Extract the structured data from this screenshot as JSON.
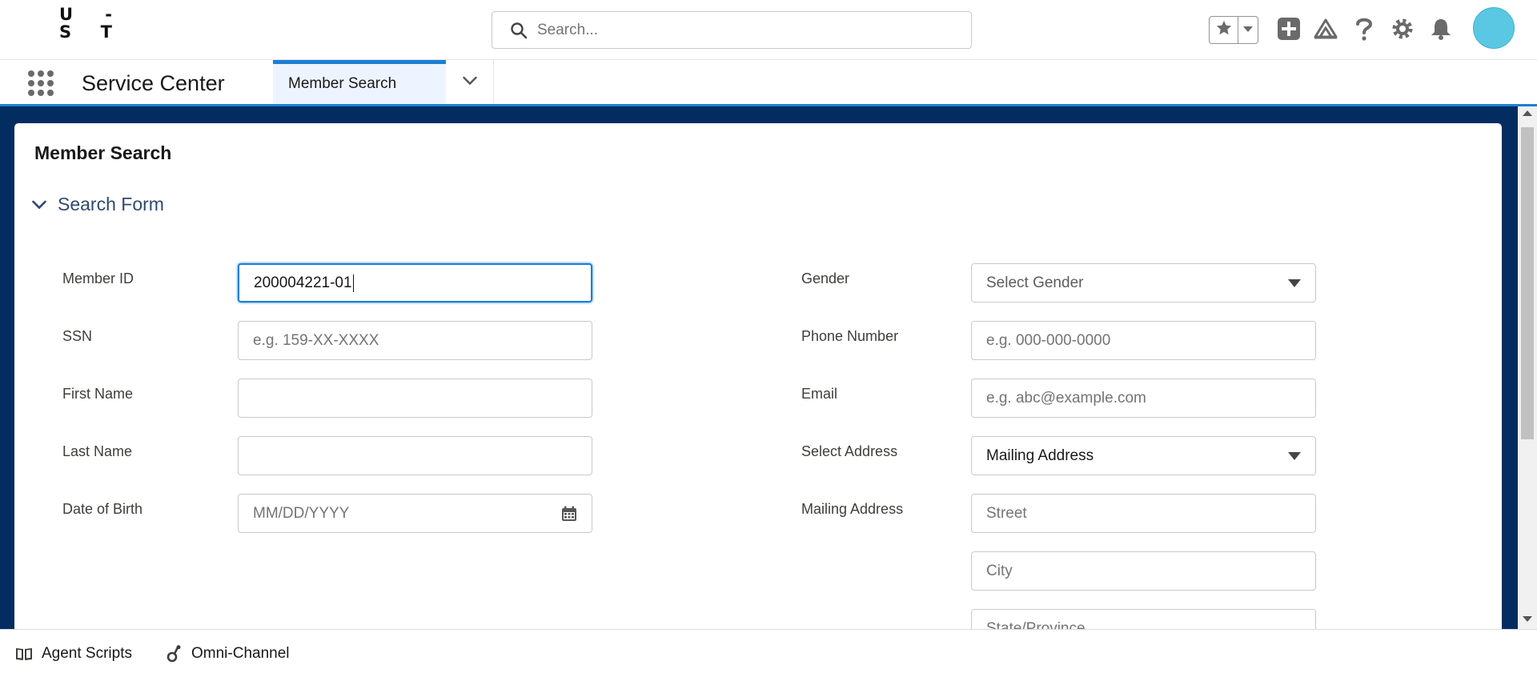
{
  "header": {
    "logo_line1": [
      "U",
      "-"
    ],
    "logo_line2": [
      "S",
      "T"
    ],
    "search_placeholder": "Search...",
    "icons": [
      "star-icon",
      "chevron-down-icon",
      "add-icon",
      "trailhead-icon",
      "help-icon",
      "gear-icon",
      "bell-icon"
    ],
    "avatar_color": "#5ac8e3"
  },
  "nav": {
    "app_name": "Service Center",
    "tabs": [
      {
        "label": "Member Search",
        "active": true
      }
    ]
  },
  "page": {
    "title": "Member Search",
    "section_label": "Search Form"
  },
  "form": {
    "member_id": {
      "label": "Member ID",
      "value": "200004221-01"
    },
    "ssn": {
      "label": "SSN",
      "placeholder": "e.g. 159-XX-XXXX"
    },
    "first_name": {
      "label": "First Name",
      "value": ""
    },
    "last_name": {
      "label": "Last Name",
      "value": ""
    },
    "dob": {
      "label": "Date of Birth",
      "placeholder": "MM/DD/YYYY"
    },
    "gender": {
      "label": "Gender",
      "placeholder": "Select Gender"
    },
    "phone": {
      "label": "Phone Number",
      "placeholder": "e.g. 000-000-0000"
    },
    "email": {
      "label": "Email",
      "placeholder": "e.g. abc@example.com"
    },
    "address_type": {
      "label": "Select Address",
      "value": "Mailing Address"
    },
    "mailing_address": {
      "label": "Mailing Address",
      "street_placeholder": "Street",
      "city_placeholder": "City",
      "state_placeholder": "State/Province"
    }
  },
  "utility_bar": {
    "items": [
      {
        "label": "Agent Scripts",
        "icon": "book-icon"
      },
      {
        "label": "Omni-Channel",
        "icon": "omni-channel-icon"
      }
    ]
  },
  "colors": {
    "brand_blue": "#1b7fd3",
    "workspace_bg": "#032d60",
    "section_text": "#2e4a6d"
  }
}
